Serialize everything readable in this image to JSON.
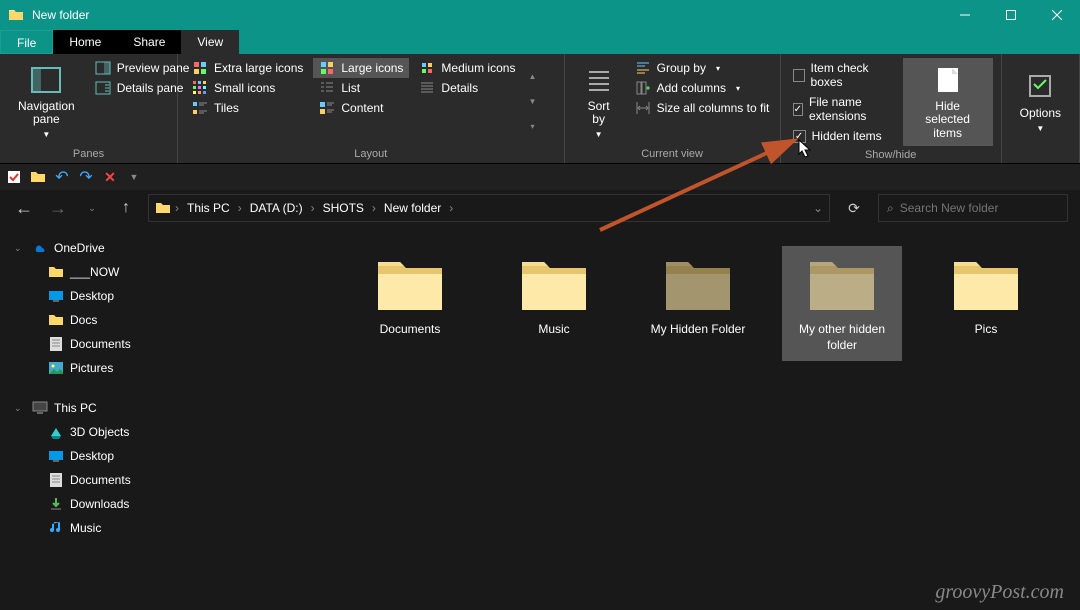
{
  "title": "New folder",
  "tabs": {
    "file": "File",
    "home": "Home",
    "share": "Share",
    "view": "View"
  },
  "ribbon": {
    "panes": {
      "label": "Panes",
      "nav": "Navigation pane",
      "preview": "Preview pane",
      "details": "Details pane"
    },
    "layout": {
      "label": "Layout",
      "xl": "Extra large icons",
      "lg": "Large icons",
      "md": "Medium icons",
      "sm": "Small icons",
      "list": "List",
      "details": "Details",
      "tiles": "Tiles",
      "content": "Content"
    },
    "current": {
      "label": "Current view",
      "sort": "Sort by",
      "group": "Group by",
      "addcols": "Add columns",
      "sizecols": "Size all columns to fit"
    },
    "showhide": {
      "label": "Show/hide",
      "checkboxes": "Item check boxes",
      "ext": "File name extensions",
      "hidden": "Hidden items",
      "hidesel": "Hide selected items"
    },
    "options": "Options"
  },
  "breadcrumbs": [
    "This PC",
    "DATA (D:)",
    "SHOTS",
    "New folder"
  ],
  "search_placeholder": "Search New folder",
  "tree": {
    "onedrive": "OneDrive",
    "items1": [
      "___NOW",
      "Desktop",
      "Docs",
      "Documents",
      "Pictures"
    ],
    "thispc": "This PC",
    "items2": [
      "3D Objects",
      "Desktop",
      "Documents",
      "Downloads",
      "Music"
    ]
  },
  "folders": [
    {
      "name": "Documents",
      "hidden": false,
      "selected": false
    },
    {
      "name": "Music",
      "hidden": false,
      "selected": false
    },
    {
      "name": "My Hidden Folder",
      "hidden": true,
      "selected": false
    },
    {
      "name": "My other hidden folder",
      "hidden": true,
      "selected": true
    },
    {
      "name": "Pics",
      "hidden": false,
      "selected": false
    }
  ],
  "watermark": "groovyPost.com"
}
